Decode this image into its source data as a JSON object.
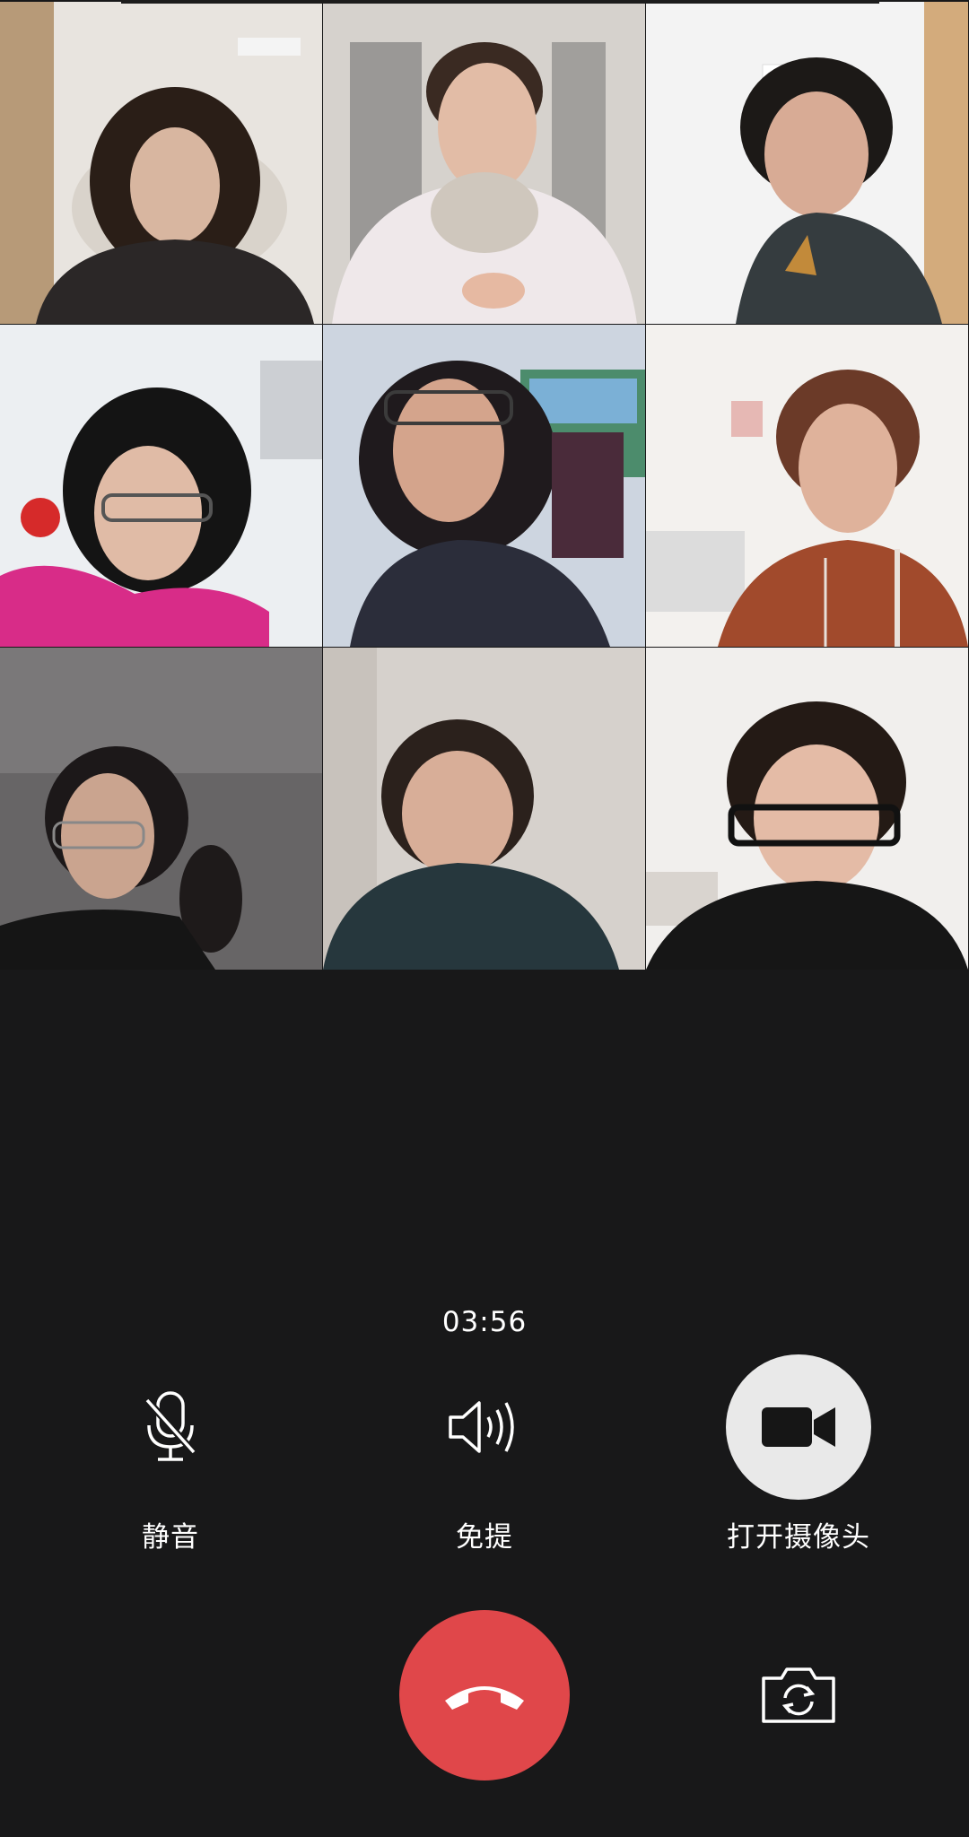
{
  "call": {
    "duration": "03:56"
  },
  "controls": {
    "mute_label": "静音",
    "speaker_label": "免提",
    "camera_label": "打开摄像头"
  },
  "participants": [
    {
      "tile": "r1c1"
    },
    {
      "tile": "r1c2"
    },
    {
      "tile": "r1c3"
    },
    {
      "tile": "r2c1"
    },
    {
      "tile": "r2c2"
    },
    {
      "tile": "r2c3"
    },
    {
      "tile": "r3c1"
    },
    {
      "tile": "r3c2"
    },
    {
      "tile": "r3c3"
    }
  ],
  "icons": {
    "mute": "microphone-off-icon",
    "speaker": "speaker-icon",
    "camera": "video-camera-icon",
    "end_call": "phone-hangup-icon",
    "switch_camera": "camera-switch-icon"
  },
  "colors": {
    "background": "#181819",
    "end_call": "#e0474a",
    "camera_button": "#e9e9e9",
    "text": "#ffffff"
  }
}
